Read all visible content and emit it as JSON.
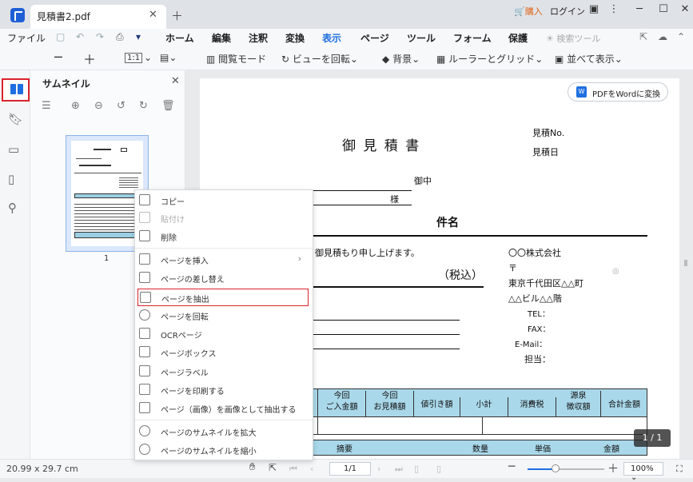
{
  "titlebar": {
    "tab_title": "見積書2.pdf",
    "cart_label": "購入",
    "login_label": "ログイン"
  },
  "menubar": {
    "file": "ファイル",
    "tabs": [
      "ホーム",
      "編集",
      "注釈",
      "変換",
      "表示",
      "ページ",
      "ツール",
      "フォーム",
      "保護"
    ],
    "active_tab": "表示",
    "search_tools": "検索ツール"
  },
  "toolbar": {
    "zoom_preset": "1:1",
    "reading_mode": "閲覧モード",
    "rotate_view": "ビューを回転",
    "background": "背景",
    "ruler_grid": "ルーラーとグリッド",
    "side_by_side": "並べて表示"
  },
  "thumbnail_panel": {
    "title": "サムネイル",
    "page_number": "1"
  },
  "document": {
    "convert_button": "PDFをWordに変換",
    "convert_icon_letter": "W",
    "title": "御 見 積 書",
    "estimate_no": "見積No.",
    "estimate_date": "見積日",
    "onchu": "御中",
    "sama": "様",
    "kenmei": "件名",
    "greeting": "御見積もり申し上げます。",
    "tax_included": "（税込）",
    "company": "〇〇株式会社",
    "postal": "〒",
    "address1": "東京千代田区△△町",
    "address2": "△△ビル△△階",
    "tel": "TEL：",
    "fax": "FAX：",
    "email": "E-Mail：",
    "tanto": "担当：",
    "table_headers": [
      "今回\nご入金額",
      "今回\nお見積額",
      "値引き額",
      "小計",
      "消費税",
      "源泉\n徴収額",
      "合計金額"
    ],
    "lower_headers": [
      "摘要",
      "数量",
      "単価",
      "金額"
    ],
    "page_badge": "1 / 1"
  },
  "context_menu": {
    "items": [
      {
        "label": "コピー",
        "enabled": true
      },
      {
        "label": "貼付け",
        "enabled": false
      },
      {
        "label": "削除",
        "enabled": true
      },
      {
        "label": "ページを挿入",
        "enabled": true,
        "submenu": true
      },
      {
        "label": "ページの差し替え",
        "enabled": true
      },
      {
        "label": "ページを抽出",
        "enabled": true,
        "highlighted": true
      },
      {
        "label": "ページを回転",
        "enabled": true
      },
      {
        "label": "OCRページ",
        "enabled": true
      },
      {
        "label": "ページボックス",
        "enabled": true
      },
      {
        "label": "ページラベル",
        "enabled": true
      },
      {
        "label": "ページを印刷する",
        "enabled": true
      },
      {
        "label": "ページ（画像）を画像として抽出する",
        "enabled": true
      },
      {
        "label": "ページのサムネイルを拡大",
        "enabled": true
      },
      {
        "label": "ページのサムネイルを縮小",
        "enabled": true
      }
    ]
  },
  "statusbar": {
    "page_size": "20.99 x 29.7 cm",
    "page_field": "1/1",
    "zoom": "100%",
    "zoom_fraction": 0.35
  },
  "colors": {
    "accent": "#1f6fe0",
    "highlight_border": "#d9232d",
    "table_header_fill": "#a9d8ea"
  }
}
